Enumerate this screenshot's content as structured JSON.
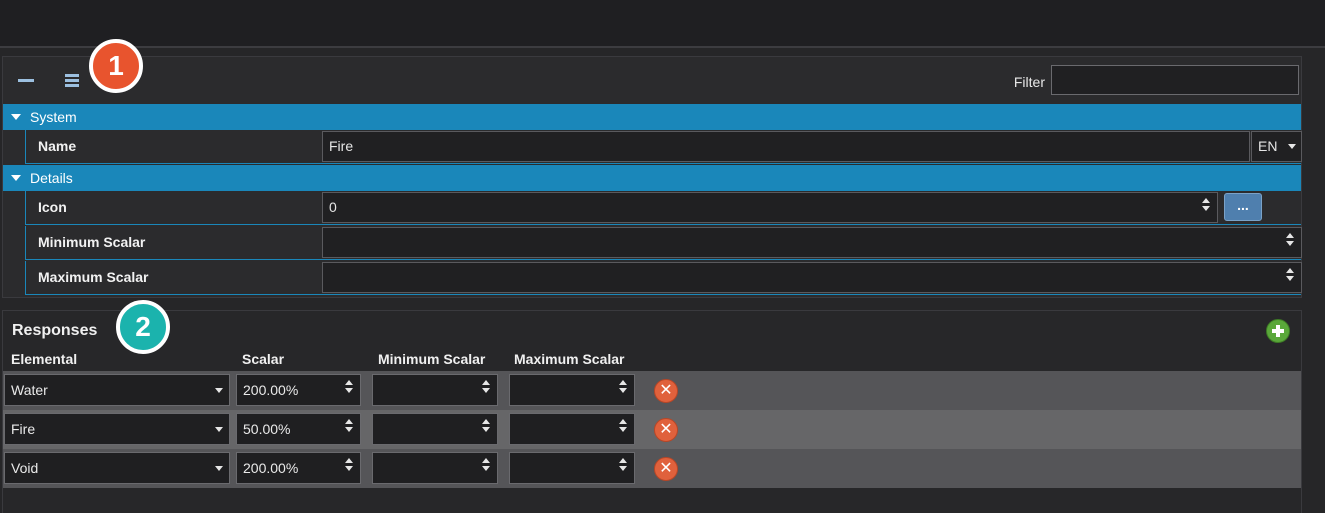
{
  "toolbar": {
    "collapse_icon": "minus-icon",
    "categorize_icon": "list-icon",
    "filter_label": "Filter",
    "filter_value": ""
  },
  "badges": {
    "first": "1",
    "second": "2"
  },
  "properties": {
    "system": {
      "header": "System",
      "name_label": "Name",
      "name_value": "Fire",
      "language": "EN"
    },
    "details": {
      "header": "Details",
      "icon_label": "Icon",
      "icon_value": "0",
      "browse_label": "...",
      "min_label": "Minimum Scalar",
      "min_value": "",
      "max_label": "Maximum Scalar",
      "max_value": ""
    }
  },
  "responses": {
    "title": "Responses",
    "columns": [
      "Elemental",
      "Scalar",
      "Minimum Scalar",
      "Maximum Scalar"
    ],
    "rows": [
      {
        "elemental": "Water",
        "scalar": "200.00%",
        "min": "",
        "max": ""
      },
      {
        "elemental": "Fire",
        "scalar": "50.00%",
        "min": "",
        "max": ""
      },
      {
        "elemental": "Void",
        "scalar": "200.00%",
        "min": "",
        "max": ""
      }
    ]
  },
  "colors": {
    "category_header": "#1a87ba",
    "badge_orange": "#e8542e",
    "badge_teal": "#1bb3ad",
    "add_green": "#5aa83a",
    "delete_red": "#e0613c"
  }
}
